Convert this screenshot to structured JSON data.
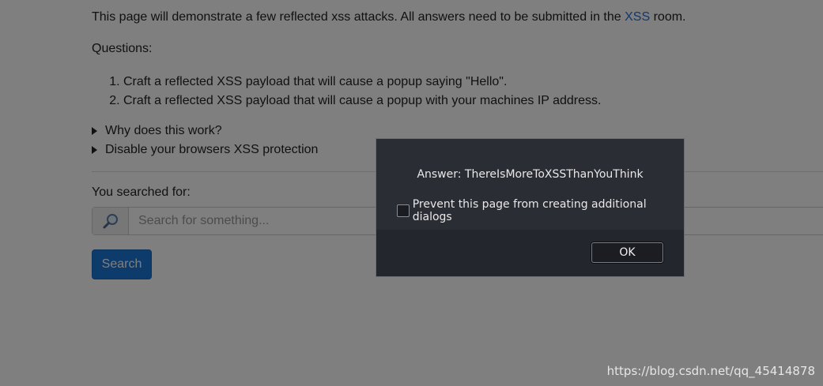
{
  "intro": {
    "before": "This page will demonstrate a few reflected xss attacks. All answers need to be submitted in the ",
    "link": "XSS",
    "after": " room."
  },
  "questions_label": "Questions:",
  "questions": [
    "Craft a reflected XSS payload that will cause a popup saying \"Hello\".",
    "Craft a reflected XSS payload that will cause a popup with your machines IP address."
  ],
  "details": [
    "Why does this work?",
    "Disable your browsers XSS protection"
  ],
  "searched_label": "You searched for:",
  "search": {
    "placeholder": "Search for something...",
    "button": "Search"
  },
  "dialog": {
    "message": "Answer: ThereIsMoreToXSSThanYouThink",
    "checkbox_label": "Prevent this page from creating additional dialogs",
    "ok_label": "OK"
  },
  "watermark": "https://blog.csdn.net/qq_45414878",
  "colors": {
    "link": "#2a6cd6",
    "button": "#1a78d8",
    "dialog_bg": "#24262e"
  }
}
